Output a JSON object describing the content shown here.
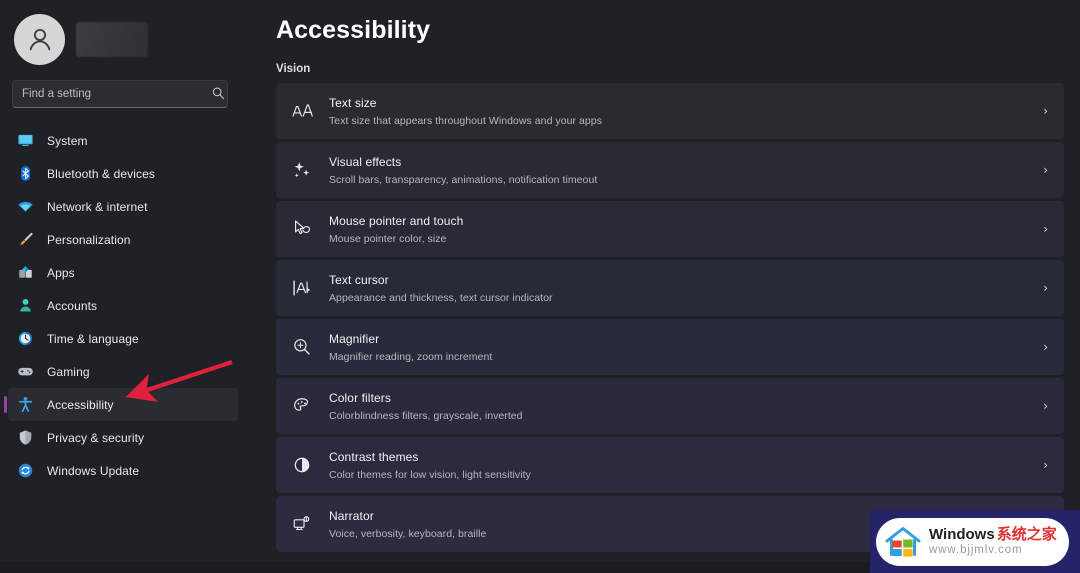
{
  "account": {
    "avatar_icon": "person-avatar-icon",
    "name_redacted": true
  },
  "search": {
    "placeholder": "Find a setting",
    "value": "",
    "icon": "search-icon"
  },
  "sidebar": {
    "items": [
      {
        "label": "System",
        "icon": "monitor-icon",
        "selected": false
      },
      {
        "label": "Bluetooth & devices",
        "icon": "bluetooth-icon",
        "selected": false
      },
      {
        "label": "Network & internet",
        "icon": "wifi-icon",
        "selected": false
      },
      {
        "label": "Personalization",
        "icon": "paintbrush-icon",
        "selected": false
      },
      {
        "label": "Apps",
        "icon": "apps-grid-icon",
        "selected": false
      },
      {
        "label": "Accounts",
        "icon": "person-icon",
        "selected": false
      },
      {
        "label": "Time & language",
        "icon": "clock-icon",
        "selected": false
      },
      {
        "label": "Gaming",
        "icon": "gamepad-icon",
        "selected": false
      },
      {
        "label": "Accessibility",
        "icon": "accessibility-icon",
        "selected": true
      },
      {
        "label": "Privacy & security",
        "icon": "shield-icon",
        "selected": false
      },
      {
        "label": "Windows Update",
        "icon": "update-sync-icon",
        "selected": false
      }
    ],
    "selected_accent_color": "#9a3fa8"
  },
  "main": {
    "title": "Accessibility",
    "section_label": "Vision",
    "chevron": "›",
    "rows": [
      {
        "title": "Text size",
        "subtitle": "Text size that appears throughout Windows and your apps",
        "icon": "text-size-aa-icon"
      },
      {
        "title": "Visual effects",
        "subtitle": "Scroll bars, transparency, animations, notification timeout",
        "icon": "sparkles-icon"
      },
      {
        "title": "Mouse pointer and touch",
        "subtitle": "Mouse pointer color, size",
        "icon": "mouse-pointer-icon"
      },
      {
        "title": "Text cursor",
        "subtitle": "Appearance and thickness, text cursor indicator",
        "icon": "text-cursor-icon"
      },
      {
        "title": "Magnifier",
        "subtitle": "Magnifier reading, zoom increment",
        "icon": "magnifier-icon"
      },
      {
        "title": "Color filters",
        "subtitle": "Colorblindness filters, grayscale, inverted",
        "icon": "color-palette-icon"
      },
      {
        "title": "Contrast themes",
        "subtitle": "Color themes for low vision, light sensitivity",
        "icon": "contrast-circle-icon"
      },
      {
        "title": "Narrator",
        "subtitle": "Voice, verbosity, keyboard, braille",
        "icon": "narrator-icon"
      }
    ]
  },
  "annotation": {
    "arrow_color": "#e0213c",
    "points_to": "Accessibility"
  },
  "watermark": {
    "brand_en": "Windows",
    "brand_cn": "系统之家",
    "url": "www.bjjmlv.com",
    "logo_icon": "windows-house-logo-icon"
  }
}
